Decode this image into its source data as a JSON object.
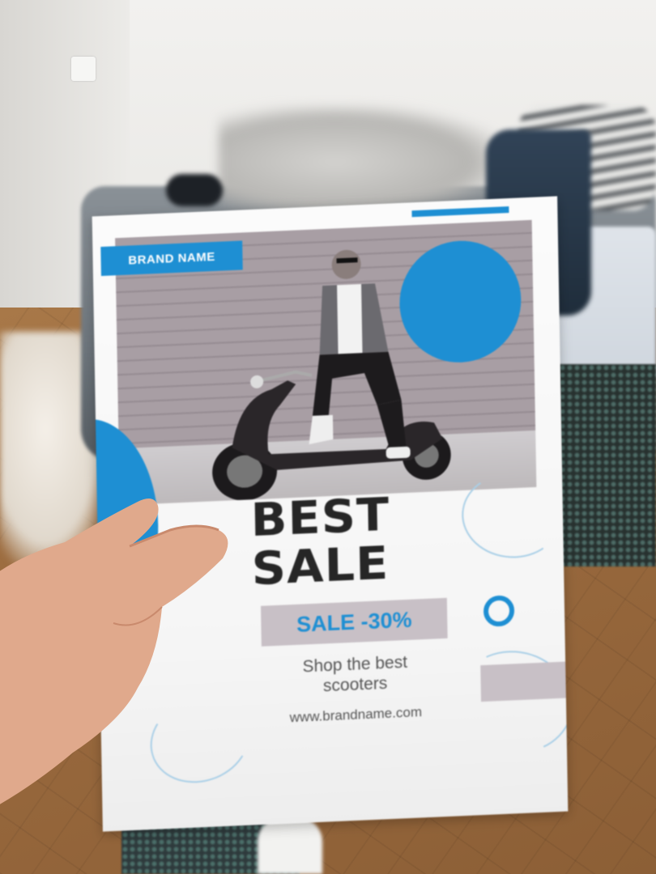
{
  "flyer": {
    "brand": "BRAND NAME",
    "headline_line1": "BEST",
    "headline_line2": "SALE",
    "discount": "SALE -30%",
    "tagline_line1": "Shop the best",
    "tagline_line2": "scooters",
    "url": "www.brandname.com"
  },
  "colors": {
    "accent": "#1e8fd3",
    "panel": "#c8c0c6",
    "headline": "#262626"
  }
}
